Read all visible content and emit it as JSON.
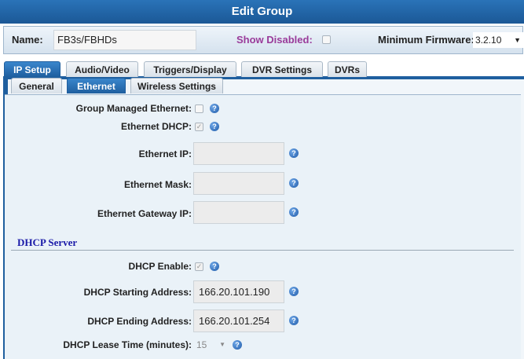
{
  "window": {
    "title": "Edit Group"
  },
  "header": {
    "name_label": "Name:",
    "name_value": "FB3s/FBHDs",
    "show_disabled_label": "Show Disabled:",
    "min_firmware_label": "Minimum Firmware:",
    "min_firmware_value": "3.2.10",
    "show_disabled_checked": false
  },
  "tabs": [
    {
      "label": "IP Setup",
      "active": true
    },
    {
      "label": "Audio/Video",
      "active": false
    },
    {
      "label": "Triggers/Display",
      "active": false
    },
    {
      "label": "DVR Settings",
      "active": false
    },
    {
      "label": "DVRs",
      "active": false
    }
  ],
  "subtabs": [
    {
      "label": "General",
      "active": false
    },
    {
      "label": "Ethernet",
      "active": true
    },
    {
      "label": "Wireless Settings",
      "active": false
    }
  ],
  "ethernet": {
    "group_managed_label": "Group Managed Ethernet:",
    "group_managed_checked": false,
    "dhcp_label": "Ethernet DHCP:",
    "dhcp_checked": true,
    "ip_label": "Ethernet IP:",
    "ip_value": "",
    "mask_label": "Ethernet Mask:",
    "mask_value": "",
    "gateway_label": "Ethernet Gateway IP:",
    "gateway_value": ""
  },
  "dhcp_server": {
    "section_title": "DHCP Server",
    "enable_label": "DHCP Enable:",
    "enable_checked": true,
    "start_label": "DHCP Starting Address:",
    "start_value": "166.20.101.190",
    "end_label": "DHCP Ending Address:",
    "end_value": "166.20.101.254",
    "lease_label": "DHCP Lease Time (minutes):",
    "lease_value": "15"
  },
  "icons": {
    "help": "help-icon",
    "dropdown": "chevron-down-icon",
    "check": "check-icon"
  },
  "colors": {
    "accent": "#1f5f9f",
    "section_title": "#1a1aa8",
    "show_disabled": "#9a3b9a"
  }
}
